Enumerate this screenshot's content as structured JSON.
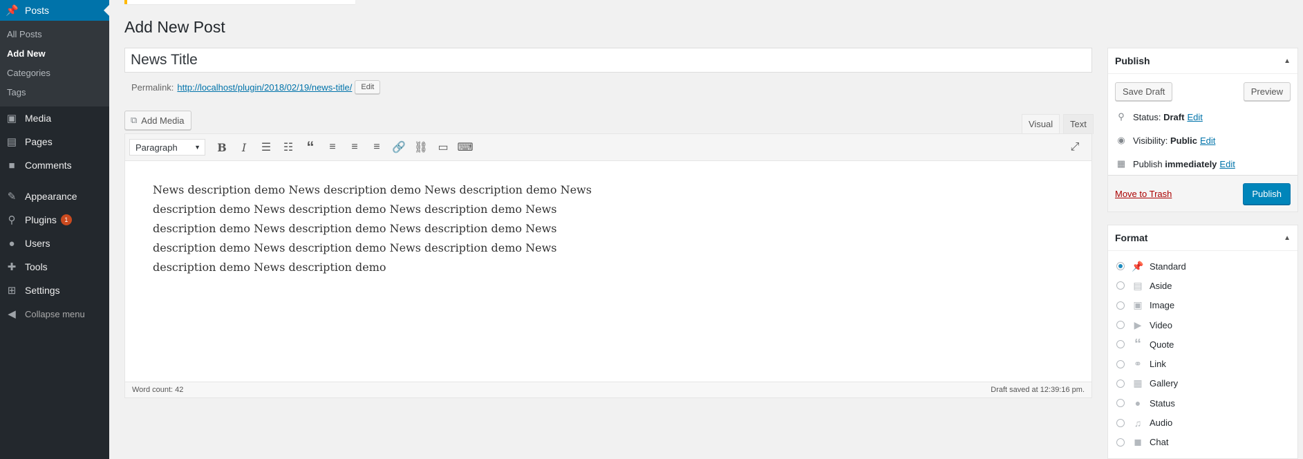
{
  "sidebar": {
    "posts_label": "Posts",
    "submenu": [
      "All Posts",
      "Add New",
      "Categories",
      "Tags"
    ],
    "items": [
      {
        "label": "Media",
        "icon": "media-icon"
      },
      {
        "label": "Pages",
        "icon": "pages-icon"
      },
      {
        "label": "Comments",
        "icon": "comments-icon"
      },
      {
        "label": "Appearance",
        "icon": "appearance-icon"
      },
      {
        "label": "Plugins",
        "icon": "plugins-icon",
        "badge": "1"
      },
      {
        "label": "Users",
        "icon": "users-icon"
      },
      {
        "label": "Tools",
        "icon": "tools-icon"
      },
      {
        "label": "Settings",
        "icon": "settings-icon"
      }
    ],
    "collapse_label": "Collapse menu"
  },
  "page": {
    "title": "Add New Post",
    "post_title_value": "News Title",
    "permalink_label": "Permalink:",
    "permalink_url": "http://localhost/plugin/2018/02/19/news-title/",
    "permalink_edit": "Edit"
  },
  "editor": {
    "add_media": "Add Media",
    "tab_visual": "Visual",
    "tab_text": "Text",
    "format_select": "Paragraph",
    "content": "News description demo News description demo News description demo News description demo News description demo News description demo News description demo News description demo News description demo News description demo News description demo News description demo News description demo News description demo",
    "word_count": "Word count: 42",
    "draft_saved": "Draft saved at 12:39:16 pm."
  },
  "publish": {
    "heading": "Publish",
    "save_draft": "Save Draft",
    "preview": "Preview",
    "status_label": "Status:",
    "status_value": "Draft",
    "visibility_label": "Visibility:",
    "visibility_value": "Public",
    "schedule_label": "Publish",
    "schedule_value": "immediately",
    "edit": "Edit",
    "move_to_trash": "Move to Trash",
    "publish_button": "Publish"
  },
  "format": {
    "heading": "Format",
    "selected": "Standard",
    "options": [
      "Standard",
      "Aside",
      "Image",
      "Video",
      "Quote",
      "Link",
      "Gallery",
      "Status",
      "Audio",
      "Chat"
    ]
  },
  "colors": {
    "accent": "#0073aa",
    "sidebar_bg": "#23282d",
    "primary_button": "#0085ba",
    "trash_link": "#aa0000",
    "badge": "#ca4a1f"
  }
}
